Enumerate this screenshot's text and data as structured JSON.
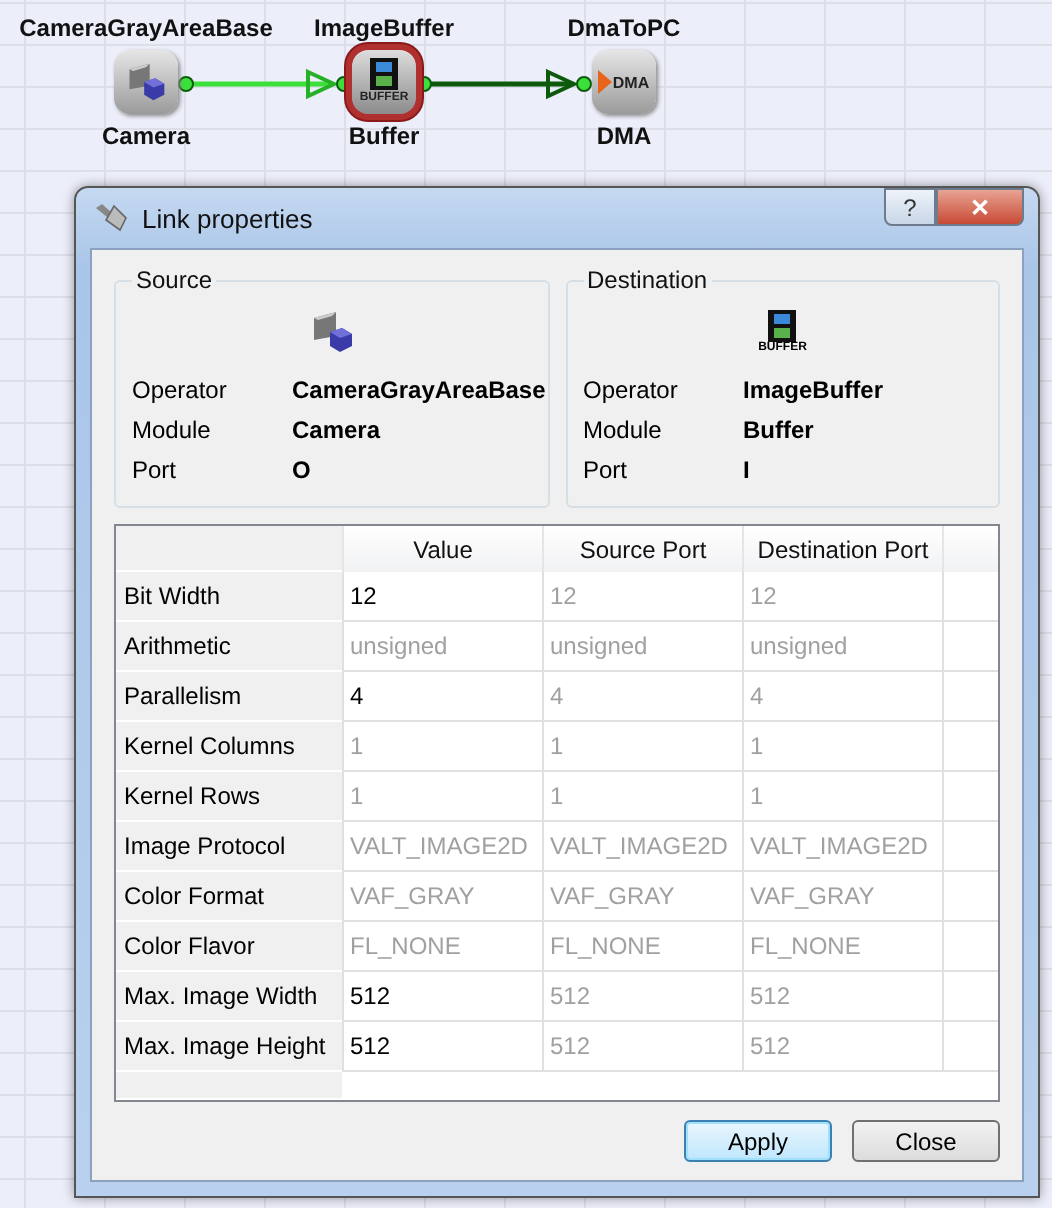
{
  "diagram": {
    "nodes": [
      {
        "operator": "CameraGrayAreaBase",
        "module": "Camera",
        "kind": "camera",
        "selected": false
      },
      {
        "operator": "ImageBuffer",
        "module": "Buffer",
        "kind": "buffer",
        "badge": "BUFFER",
        "selected": true
      },
      {
        "operator": "DmaToPC",
        "module": "DMA",
        "kind": "dma",
        "badge": "DMA",
        "selected": false
      }
    ],
    "links": [
      {
        "selected": true
      },
      {
        "selected": false
      }
    ]
  },
  "dialog": {
    "title": "Link properties",
    "title_buttons": [
      "?",
      "✕"
    ],
    "source": {
      "title": "Source",
      "kind": "camera",
      "fields": [
        {
          "label": "Operator",
          "value": "CameraGrayAreaBase"
        },
        {
          "label": "Module",
          "value": "Camera"
        },
        {
          "label": "Port",
          "value": "O"
        }
      ]
    },
    "destination": {
      "title": "Destination",
      "kind": "buffer",
      "icon_caption": "BUFFER",
      "fields": [
        {
          "label": "Operator",
          "value": "ImageBuffer"
        },
        {
          "label": "Module",
          "value": "Buffer"
        },
        {
          "label": "Port",
          "value": "I"
        }
      ]
    },
    "table": {
      "columns": [
        "Value",
        "Source Port",
        "Destination Port"
      ],
      "rows": [
        {
          "label": "Bit Width",
          "cells": [
            {
              "text": "12",
              "disabled": false
            },
            {
              "text": "12",
              "disabled": true
            },
            {
              "text": "12",
              "disabled": true
            }
          ]
        },
        {
          "label": "Arithmetic",
          "cells": [
            {
              "text": "unsigned",
              "disabled": true
            },
            {
              "text": "unsigned",
              "disabled": true
            },
            {
              "text": "unsigned",
              "disabled": true
            }
          ]
        },
        {
          "label": "Parallelism",
          "cells": [
            {
              "text": "4",
              "disabled": false
            },
            {
              "text": "4",
              "disabled": true
            },
            {
              "text": "4",
              "disabled": true
            }
          ]
        },
        {
          "label": "Kernel Columns",
          "cells": [
            {
              "text": "1",
              "disabled": true
            },
            {
              "text": "1",
              "disabled": true
            },
            {
              "text": "1",
              "disabled": true
            }
          ]
        },
        {
          "label": "Kernel Rows",
          "cells": [
            {
              "text": "1",
              "disabled": true
            },
            {
              "text": "1",
              "disabled": true
            },
            {
              "text": "1",
              "disabled": true
            }
          ]
        },
        {
          "label": "Image Protocol",
          "cells": [
            {
              "text": "VALT_IMAGE2D",
              "disabled": true
            },
            {
              "text": "VALT_IMAGE2D",
              "disabled": true
            },
            {
              "text": "VALT_IMAGE2D",
              "disabled": true
            }
          ]
        },
        {
          "label": "Color Format",
          "cells": [
            {
              "text": "VAF_GRAY",
              "disabled": true
            },
            {
              "text": "VAF_GRAY",
              "disabled": true
            },
            {
              "text": "VAF_GRAY",
              "disabled": true
            }
          ]
        },
        {
          "label": "Color Flavor",
          "cells": [
            {
              "text": "FL_NONE",
              "disabled": true
            },
            {
              "text": "FL_NONE",
              "disabled": true
            },
            {
              "text": "FL_NONE",
              "disabled": true
            }
          ]
        },
        {
          "label": "Max. Image Width",
          "cells": [
            {
              "text": "512",
              "disabled": false
            },
            {
              "text": "512",
              "disabled": true
            },
            {
              "text": "512",
              "disabled": true
            }
          ]
        },
        {
          "label": "Max. Image Height",
          "cells": [
            {
              "text": "512",
              "disabled": false
            },
            {
              "text": "512",
              "disabled": true
            },
            {
              "text": "512",
              "disabled": true
            }
          ]
        }
      ]
    },
    "buttons": [
      {
        "label": "Apply",
        "default": true
      },
      {
        "label": "Close",
        "default": false
      }
    ]
  }
}
